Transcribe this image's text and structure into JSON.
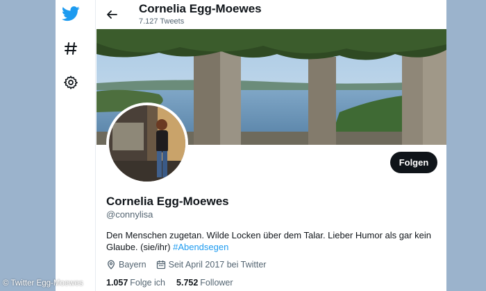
{
  "header": {
    "name": "Cornelia Egg-Moewes",
    "tweet_count": "7.127 Tweets"
  },
  "profile": {
    "name": "Cornelia Egg-Moewes",
    "handle": "@connylisa",
    "bio_text": "Den Menschen zugetan. Wilde Locken über dem Talar. Lieber Humor als gar kein Glaube. (sie/ihr) ",
    "bio_hashtag": "#Abendsegen",
    "location": "Bayern",
    "joined": "Seit April 2017 bei Twitter",
    "following_count": "1.057",
    "following_label": "Folge ich",
    "followers_count": "5.752",
    "followers_label": "Follower",
    "follow_button": "Folgen"
  },
  "nav": {
    "icons": [
      "twitter-bird-icon",
      "hashtag-icon",
      "gear-icon"
    ]
  },
  "credit": "© Twitter Egg-Moewes",
  "colors": {
    "accent": "#1d9bf0",
    "text": "#0f1419",
    "muted": "#536471",
    "page_bg": "#9bb3cc"
  }
}
